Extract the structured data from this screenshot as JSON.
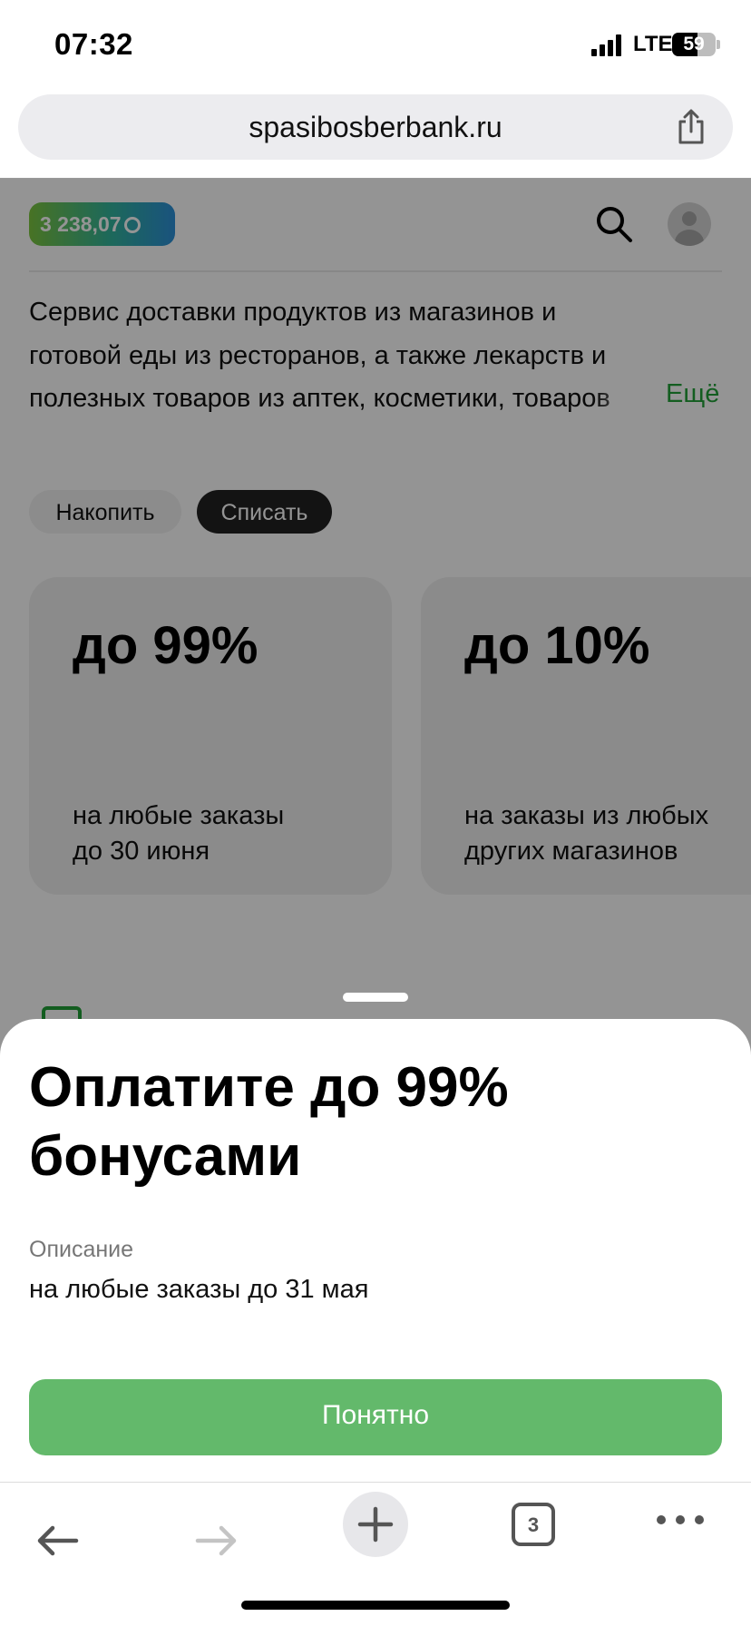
{
  "status_bar": {
    "time": "07:32",
    "network": "LTE",
    "battery": "59"
  },
  "browser": {
    "url": "spasibosberbank.ru",
    "tabs_count": "3"
  },
  "header": {
    "balance": "3 238,07"
  },
  "description": {
    "line1": "Сервис доставки продуктов из магазинов и",
    "line2": "готовой еды из ресторанов, а также лекарств и",
    "line3": "полезных товаров из аптек, косметики, товаров",
    "more": "Ещё"
  },
  "chips": {
    "accumulate": "Накопить",
    "spend": "Списать",
    "active": "spend"
  },
  "offers": [
    {
      "title": "до 99%",
      "line1": "на любые заказы",
      "line2": "до 30 июня"
    },
    {
      "title": "до 10%",
      "line1": "на заказы из любых",
      "line2": "других магазинов"
    }
  ],
  "sheet": {
    "title": "Оплатите до 99% бонусами",
    "label": "Описание",
    "value": "на любые заказы до 31 мая",
    "button": "Понятно"
  },
  "colors": {
    "accent": "#21a038",
    "button": "#63b96b"
  },
  "icons": [
    "signal-icon",
    "battery-icon",
    "share-icon",
    "search-icon",
    "avatar-icon",
    "back-icon",
    "forward-icon",
    "plus-icon",
    "tabs-icon",
    "more-icon"
  ]
}
